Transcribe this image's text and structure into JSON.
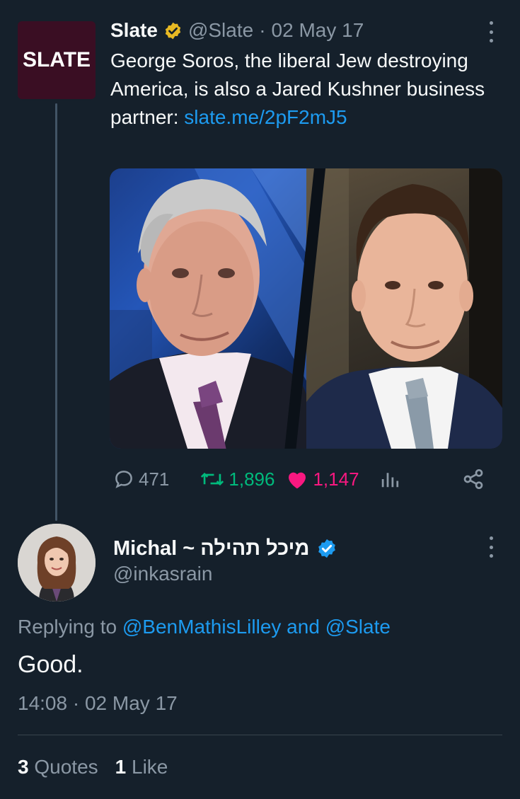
{
  "quoted_tweet": {
    "avatar_text": "SLATE",
    "name": "Slate",
    "handle": "@Slate",
    "separator": "·",
    "date": "02 May 17",
    "text": "George Soros, the liberal Jew destroying America, is also a Jared Kushner business partner: ",
    "link": "slate.me/2pF2mJ5",
    "media_alt": "Photos of George Soros and Jared Kushner side by side",
    "replies": "471",
    "retweets": "1,896",
    "likes": "1,147",
    "reply_color": "#8b98a5",
    "retweet_color": "#00ba7c",
    "like_color": "#f91880"
  },
  "reply_tweet": {
    "name": "Michal ~ מיכל תהילה",
    "handle": "@inkasrain",
    "replying_prefix": "Replying to ",
    "replying_user1": "@BenMathisLilley",
    "replying_and": " and ",
    "replying_user2": "@Slate",
    "text": "Good.",
    "time": "14:08",
    "separator": "·",
    "date": "02 May 17",
    "quotes_count": "3",
    "quotes_label": "Quotes",
    "likes_count": "1",
    "likes_label": "Like"
  },
  "colors": {
    "background": "#15202b",
    "accent": "#1d9bf0",
    "muted": "#8b98a5",
    "slate_brand": "#3a0e23",
    "verified_gold": "#e8b923"
  }
}
